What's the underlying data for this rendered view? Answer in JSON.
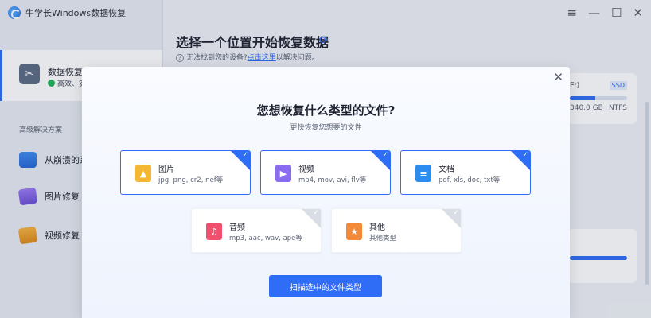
{
  "app": {
    "title": "牛学长Windows数据恢复"
  },
  "window_controls": [
    "menu-icon",
    "minimize-icon",
    "maximize-icon",
    "close-icon"
  ],
  "sidebar": {
    "active_item": {
      "label": "数据恢复",
      "status": "高效、安"
    },
    "section_label": "高级解决方案",
    "items": [
      {
        "label": "从崩溃的系",
        "icon": "monitor-icon"
      },
      {
        "label": "图片修复",
        "icon": "photo-repair-icon"
      },
      {
        "label": "视频修复",
        "icon": "video-repair-icon"
      }
    ]
  },
  "main": {
    "title": "选择一个位置开始恢复数据",
    "help_prefix": "无法找到您的设备?",
    "help_link": "点击这里",
    "help_suffix": "以解决问题。",
    "disk": {
      "label": "E:)",
      "type": "SSD",
      "size": "340.0 GB",
      "fs": "NTFS",
      "usage": 0.45
    }
  },
  "modal": {
    "title": "您想恢复什么类型的文件?",
    "subtitle": "更快恢复您想要的文件",
    "cards": [
      {
        "name": "图片",
        "desc": "jpg, png, cr2, nef等",
        "selected": true,
        "color": "#f5b731",
        "icon": "image-icon"
      },
      {
        "name": "视频",
        "desc": "mp4, mov, avi, flv等",
        "selected": true,
        "color": "#8a6cf0",
        "icon": "video-icon"
      },
      {
        "name": "文档",
        "desc": "pdf, xls, doc, txt等",
        "selected": true,
        "color": "#2d8cf0",
        "icon": "document-icon"
      },
      {
        "name": "音频",
        "desc": "mp3, aac, wav, ape等",
        "selected": false,
        "color": "#f0506e",
        "icon": "audio-icon"
      },
      {
        "name": "其他",
        "desc": "其他类型",
        "selected": false,
        "color": "#f28a3a",
        "icon": "other-icon"
      }
    ],
    "scan_button": "扫描选中的文件类型"
  }
}
